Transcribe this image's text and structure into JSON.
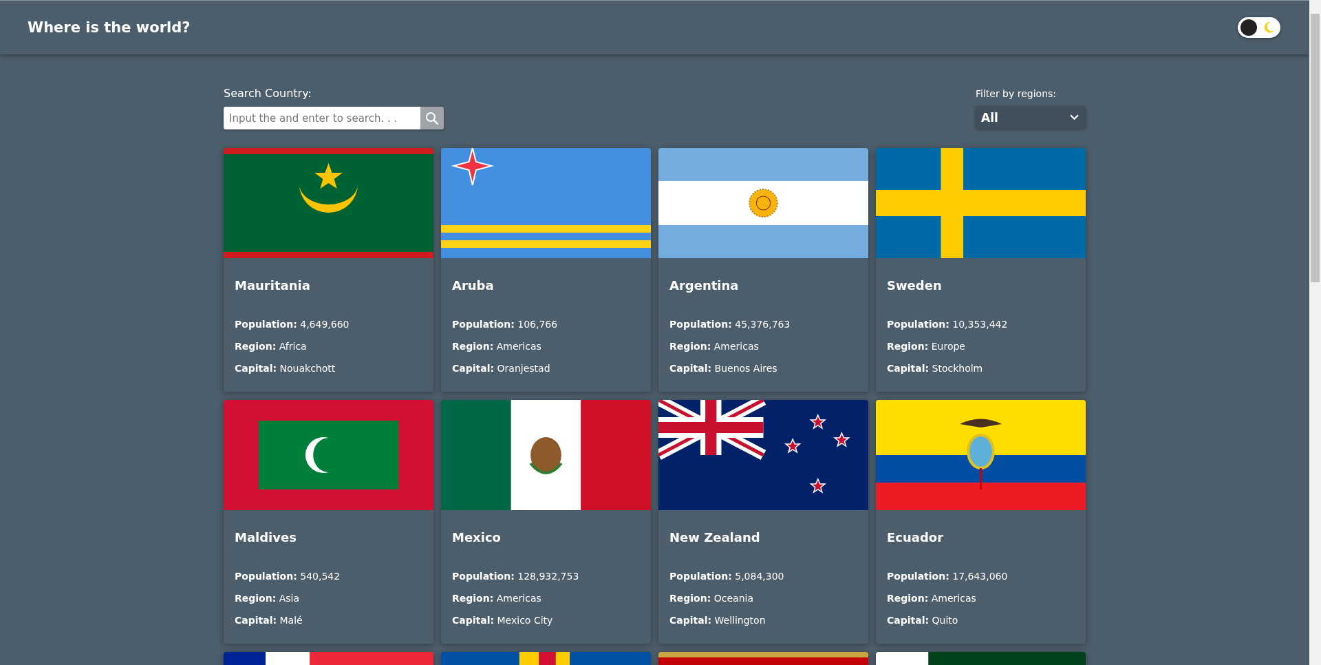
{
  "header": {
    "title": "Where is the world?",
    "theme_toggle": {
      "on": true
    }
  },
  "search": {
    "label": "Search Country:",
    "placeholder": "Input the and enter to search. . ."
  },
  "filter": {
    "label": "Filter by regions:",
    "value": "All"
  },
  "cards": [
    {
      "kind": "mauritania",
      "name": "Mauritania",
      "details": [
        "**Population:** 4,649,660",
        "**Region:** Africa",
        "**Capital:** Nouakchott"
      ]
    },
    {
      "kind": "aruba",
      "name": "Aruba",
      "details": [
        "**Population:** 106,766",
        "**Region:** Americas",
        "**Capital:** Oranjestad"
      ]
    },
    {
      "kind": "argentina",
      "name": "Argentina",
      "details": [
        "**Population:** 45,376,763",
        "**Region:** Americas",
        "**Capital:** Buenos Aires"
      ]
    },
    {
      "kind": "sweden",
      "name": "Sweden",
      "details": [
        "**Population:** 10,353,442",
        "**Region:** Europe",
        "**Capital:** Stockholm"
      ]
    },
    {
      "kind": "maldives",
      "name": "Maldives",
      "details": [
        "**Population:** 540,542",
        "**Region:** Asia",
        "**Capital:** Malé"
      ]
    },
    {
      "kind": "mexico",
      "name": "Mexico",
      "details": [
        "**Population:** 128,932,753",
        "**Region:** Americas",
        "**Capital:** Mexico City"
      ]
    },
    {
      "kind": "newzealand",
      "name": "New Zealand",
      "details": [
        "**Population:** 5,084,300",
        "**Region:** Oceania",
        "**Capital:** Wellington"
      ]
    },
    {
      "kind": "ecuador",
      "name": "Ecuador",
      "details": [
        "**Population:** 17,643,060",
        "**Region:** Americas",
        "**Capital:** Quito"
      ]
    },
    {
      "kind": "tricolor"
    },
    {
      "kind": "bluecross"
    },
    {
      "kind": "goldred"
    },
    {
      "kind": "whitegreen"
    }
  ]
}
